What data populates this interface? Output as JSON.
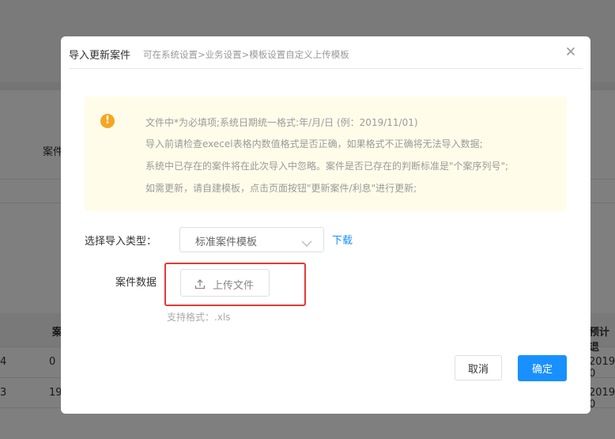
{
  "background": {
    "filter_label": "案件",
    "table_header_left": "案",
    "table_header_right": "预计退",
    "rows": [
      {
        "c1": "4",
        "c2": "0",
        "c3": "2019-0"
      },
      {
        "c1": "3",
        "c2": "19",
        "c3": "2019-0"
      }
    ]
  },
  "dialog": {
    "title": "导入更新案件",
    "subtitle": "可在系统设置>业务设置>模板设置自定义上传模板",
    "notice": {
      "lines": [
        "文件中*为必填项;系统日期统一格式:年/月/日 (例：2019/11/01)",
        "导入前请检查execel表格内数值格式是否正确，如果格式不正确将无法导入数据;",
        "系统中已存在的案件将在此次导入中忽略。案件是否已存在的判断标准是\"个案序列号\";",
        "如需更新，请自建模板，点击页面按钮\"更新案件/利息\"进行更新;"
      ]
    },
    "import_type_label": "选择导入类型：",
    "import_type_value": "标准案件模板",
    "download_label": "下载",
    "case_data_label": "案件数据",
    "upload_button": "上传文件",
    "format_hint": "支持格式：.xls",
    "cancel_button": "取消",
    "ok_button": "确定"
  },
  "colors": {
    "primary": "#1890ff",
    "warning": "#f5a623",
    "highlight": "#e53935",
    "notice_bg": "#fffde9"
  }
}
